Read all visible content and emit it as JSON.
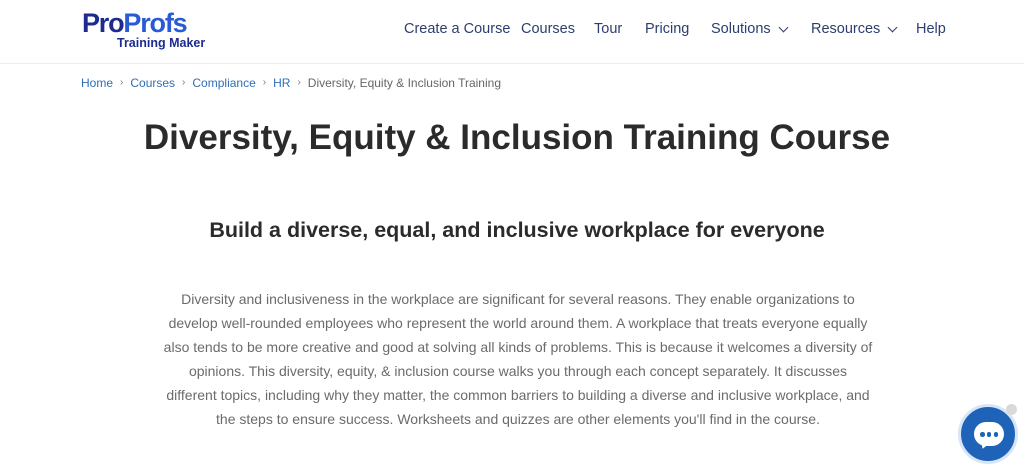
{
  "logo": {
    "pro": "Pro",
    "profs": "Profs",
    "sub": "Training Maker"
  },
  "nav": [
    {
      "label": "Create a Course"
    },
    {
      "label": "Courses"
    },
    {
      "label": "Tour"
    },
    {
      "label": "Pricing"
    },
    {
      "label": "Solutions",
      "dropdown": true
    },
    {
      "label": "Resources",
      "dropdown": true
    },
    {
      "label": "Help"
    }
  ],
  "breadcrumb": {
    "items": [
      "Home",
      "Courses",
      "Compliance",
      "HR"
    ],
    "separator": "›",
    "current": "Diversity, Equity & Inclusion Training"
  },
  "main": {
    "title": "Diversity, Equity & Inclusion Training Course",
    "subtitle": "Build a diverse, equal, and inclusive workplace for everyone",
    "description": "Diversity and inclusiveness in the workplace are significant for several reasons. They enable organizations to develop well-rounded employees who represent the world around them. A workplace that treats everyone equally also tends to be more creative and good at solving all kinds of problems. This is because it welcomes a diversity of opinions. This diversity, equity, & inclusion course walks you through each concept separately. It discusses different topics, including why they matter, the common barriers to building a diverse and inclusive workplace, and the steps to ensure success. Worksheets and quizzes are other elements you'll find in the course."
  },
  "chat": {
    "icon": "chat-icon"
  },
  "colors": {
    "brand_dark": "#1d2b8f",
    "brand_light": "#2a5bd7",
    "nav_text": "#2d3e6e",
    "link": "#2f6fb6",
    "chat_bg": "#1f63b9"
  }
}
